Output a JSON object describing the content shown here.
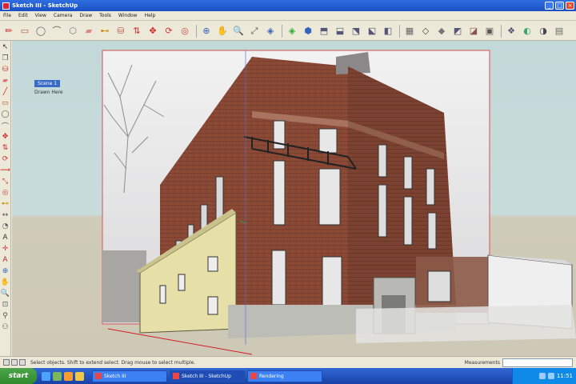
{
  "window": {
    "title": "Sketch III - SketchUp"
  },
  "menu": [
    {
      "label": "File"
    },
    {
      "label": "Edit"
    },
    {
      "label": "View"
    },
    {
      "label": "Camera"
    },
    {
      "label": "Draw"
    },
    {
      "label": "Tools"
    },
    {
      "label": "Window"
    },
    {
      "label": "Help"
    }
  ],
  "toolbar": {
    "items": [
      {
        "name": "pencil-icon",
        "glyph": "✏",
        "color": "#c22"
      },
      {
        "name": "rectangle-icon",
        "glyph": "▭",
        "color": "#a63"
      },
      {
        "name": "circle-icon",
        "glyph": "◯",
        "color": "#666"
      },
      {
        "name": "arc-icon",
        "glyph": "⌒",
        "color": "#555"
      },
      {
        "name": "polygon-icon",
        "glyph": "⬡",
        "color": "#777"
      },
      {
        "name": "eraser-icon",
        "glyph": "▰",
        "color": "#d88"
      },
      {
        "name": "tape-measure-icon",
        "glyph": "⊷",
        "color": "#c80"
      },
      {
        "name": "paint-bucket-icon",
        "glyph": "⛁",
        "color": "#b54"
      },
      {
        "name": "push-pull-icon",
        "glyph": "⇅",
        "color": "#c33"
      },
      {
        "name": "move-icon",
        "glyph": "✥",
        "color": "#c22"
      },
      {
        "name": "rotate-icon",
        "glyph": "⟳",
        "color": "#c33"
      },
      {
        "name": "offset-icon",
        "glyph": "◎",
        "color": "#c44"
      },
      {
        "name": "orbit-icon",
        "glyph": "⊕",
        "color": "#36b"
      },
      {
        "name": "pan-icon",
        "glyph": "✋",
        "color": "#555"
      },
      {
        "name": "zoom-icon",
        "glyph": "🔍",
        "color": "#555"
      },
      {
        "name": "zoom-extents-icon",
        "glyph": "⤢",
        "color": "#555"
      },
      {
        "name": "previous-view-icon",
        "glyph": "◈",
        "color": "#36b"
      },
      {
        "name": "next-view-icon",
        "glyph": "◈",
        "color": "#3a3"
      },
      {
        "name": "iso-view-icon",
        "glyph": "⬢",
        "color": "#36b"
      },
      {
        "name": "top-view-icon",
        "glyph": "⬒",
        "color": "#557"
      },
      {
        "name": "front-view-icon",
        "glyph": "⬓",
        "color": "#557"
      },
      {
        "name": "right-view-icon",
        "glyph": "⬔",
        "color": "#557"
      },
      {
        "name": "back-view-icon",
        "glyph": "⬕",
        "color": "#557"
      },
      {
        "name": "left-view-icon",
        "glyph": "◧",
        "color": "#557"
      },
      {
        "name": "xray-icon",
        "glyph": "▦",
        "color": "#666"
      },
      {
        "name": "wireframe-icon",
        "glyph": "◇",
        "color": "#444"
      },
      {
        "name": "hidden-line-icon",
        "glyph": "◆",
        "color": "#777"
      },
      {
        "name": "shaded-icon",
        "glyph": "◩",
        "color": "#557"
      },
      {
        "name": "shaded-textures-icon",
        "glyph": "◪",
        "color": "#855"
      },
      {
        "name": "monochrome-icon",
        "glyph": "▣",
        "color": "#555"
      },
      {
        "name": "components-icon",
        "glyph": "❖",
        "color": "#557"
      },
      {
        "name": "materials-icon",
        "glyph": "◐",
        "color": "#3a6"
      },
      {
        "name": "shadows-icon",
        "glyph": "◑",
        "color": "#445"
      },
      {
        "name": "fog-icon",
        "glyph": "▤",
        "color": "#666"
      }
    ]
  },
  "left_tools": [
    {
      "name": "select-tool-icon",
      "glyph": "↖",
      "color": "#333"
    },
    {
      "name": "make-component-icon",
      "glyph": "❐",
      "color": "#555"
    },
    {
      "name": "paint-tool-icon",
      "glyph": "⛁",
      "color": "#c33"
    },
    {
      "name": "eraser-tool-icon",
      "glyph": "▰",
      "color": "#d77"
    },
    {
      "name": "line-tool-icon",
      "glyph": "╱",
      "color": "#c22"
    },
    {
      "name": "rect-tool-icon",
      "glyph": "▭",
      "color": "#a52"
    },
    {
      "name": "circle-tool-icon",
      "glyph": "◯",
      "color": "#555"
    },
    {
      "name": "arc-tool-icon",
      "glyph": "⌒",
      "color": "#555"
    },
    {
      "name": "move-tool-icon",
      "glyph": "✥",
      "color": "#c22"
    },
    {
      "name": "pushpull-tool-icon",
      "glyph": "⇅",
      "color": "#c33"
    },
    {
      "name": "rotate-tool-icon",
      "glyph": "⟳",
      "color": "#c33"
    },
    {
      "name": "followme-tool-icon",
      "glyph": "⟿",
      "color": "#c33"
    },
    {
      "name": "scale-tool-icon",
      "glyph": "⤡",
      "color": "#c33"
    },
    {
      "name": "offset-tool-icon",
      "glyph": "◎",
      "color": "#c44"
    },
    {
      "name": "tape-tool-icon",
      "glyph": "⊷",
      "color": "#c80"
    },
    {
      "name": "dimension-tool-icon",
      "glyph": "↔",
      "color": "#555"
    },
    {
      "name": "protractor-tool-icon",
      "glyph": "◔",
      "color": "#555"
    },
    {
      "name": "text-tool-icon",
      "glyph": "A",
      "color": "#333"
    },
    {
      "name": "axes-tool-icon",
      "glyph": "✛",
      "color": "#c33"
    },
    {
      "name": "3dtext-tool-icon",
      "glyph": "A",
      "color": "#a33"
    },
    {
      "name": "orbit-tool-icon",
      "glyph": "⊕",
      "color": "#36b"
    },
    {
      "name": "pan-tool-icon",
      "glyph": "✋",
      "color": "#555"
    },
    {
      "name": "zoom-tool-icon",
      "glyph": "🔍",
      "color": "#555"
    },
    {
      "name": "zoom-window-tool-icon",
      "glyph": "⊡",
      "color": "#555"
    },
    {
      "name": "position-camera-icon",
      "glyph": "⚲",
      "color": "#555"
    },
    {
      "name": "walk-tool-icon",
      "glyph": "⚇",
      "color": "#555"
    }
  ],
  "scene": {
    "tab_label": "Scene 1",
    "layer_label": "Drawn Here"
  },
  "status": {
    "text": "Select objects. Shift to extend select. Drag mouse to select multiple.",
    "measurements_label": "Measurements"
  },
  "taskbar": {
    "start_label": "start",
    "quick_launch": [
      {
        "name": "ie-icon",
        "color": "#4aa3ff"
      },
      {
        "name": "desktop-icon",
        "color": "#7cb85a"
      },
      {
        "name": "media-icon",
        "color": "#ff9a2e"
      },
      {
        "name": "folder-icon",
        "color": "#f3c64a"
      }
    ],
    "tasks": [
      {
        "label": "Sketch III",
        "active": false
      },
      {
        "label": "Sketch III - SketchUp",
        "active": true
      },
      {
        "label": "Rendering",
        "active": false
      }
    ],
    "clock": "11:51"
  },
  "colors": {
    "titlebar": "#1f58d2",
    "sky": "#c3d8d8",
    "ground": "#cdc9b6",
    "brick": "#8a4b38",
    "axis_red": "#d02020",
    "axis_blue": "#5060d0",
    "axis_green": "#30a040"
  }
}
